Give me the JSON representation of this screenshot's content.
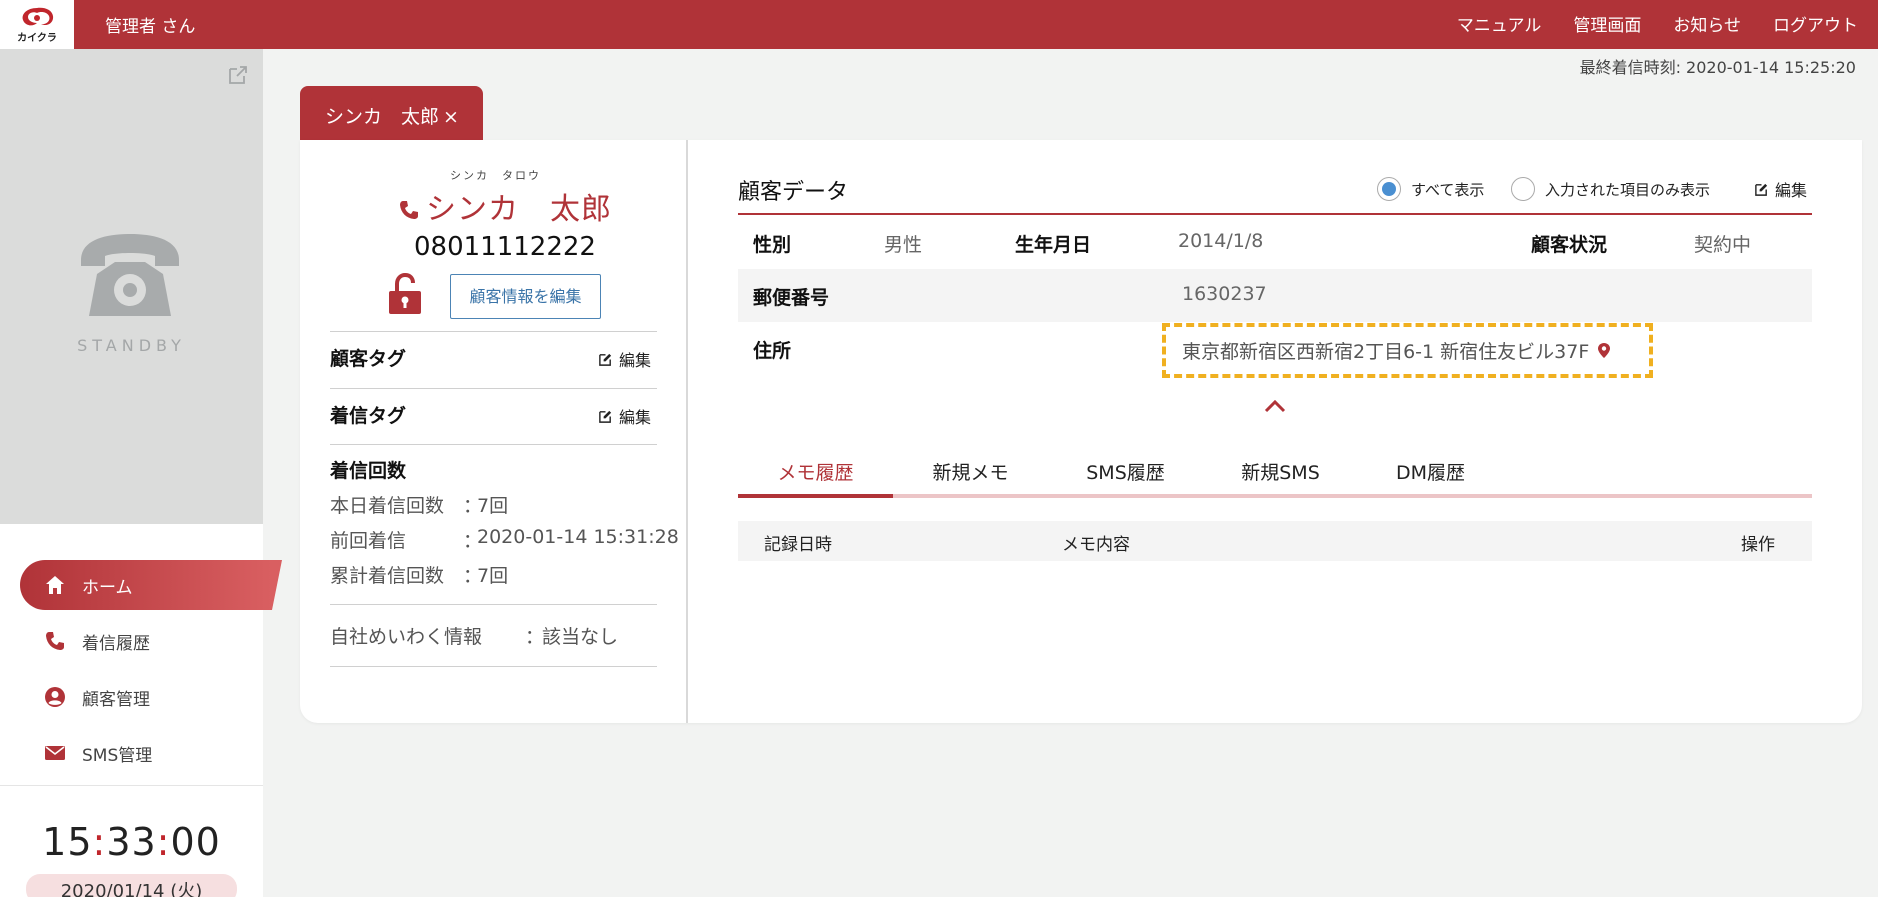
{
  "header": {
    "logo_text": "カイクラ",
    "user_name": "管理者 さん",
    "nav": [
      "マニュアル",
      "管理画面",
      "お知らせ",
      "ログアウト"
    ]
  },
  "last_call": "最終着信時刻: 2020-01-14 15:25:20",
  "sidebar": {
    "status": "STANDBY",
    "items": [
      {
        "label": "ホーム",
        "icon": "home-icon",
        "active": true
      },
      {
        "label": "着信履歴",
        "icon": "phone-icon",
        "active": false
      },
      {
        "label": "顧客管理",
        "icon": "user-circle-icon",
        "active": false
      },
      {
        "label": "SMS管理",
        "icon": "mail-icon",
        "active": false
      }
    ],
    "clock": {
      "h": "15",
      "m": "33",
      "s": "00"
    },
    "date": "2020/01/14 (火)"
  },
  "customer_tab": {
    "label": "シンカ　太郎",
    "close": "×"
  },
  "customer": {
    "kana": "シンカ　タロウ",
    "name": "シンカ　太郎",
    "phone": "08011112222",
    "edit_button": "顧客情報を編集",
    "tag_title": "顧客タグ",
    "call_tag_title": "着信タグ",
    "edit_label": "編集",
    "call_count_title": "着信回数",
    "stats": [
      {
        "label": "本日着信回数",
        "sep": "：",
        "value": "7回"
      },
      {
        "label": "前回着信",
        "sep": "：",
        "value": "2020-01-14 15:31:28"
      },
      {
        "label": "累計着信回数",
        "sep": "：",
        "value": "7回"
      }
    ],
    "meiwaku_label": "自社めいわく情報",
    "meiwaku_sep": "：",
    "meiwaku_value": "該当なし"
  },
  "customer_data": {
    "title": "顧客データ",
    "radio_all": "すべて表示",
    "radio_filled": "入力された項目のみ表示",
    "radio_selected": "すべて表示",
    "edit_label": "編集",
    "gender_label": "性別",
    "gender_value": "男性",
    "birth_label": "生年月日",
    "birth_value": "2014/1/8",
    "status_label": "顧客状況",
    "status_value": "契約中",
    "zip_label": "郵便番号",
    "zip_value": "1630237",
    "address_label": "住所",
    "address_value": "東京都新宿区西新宿2丁目6-1 新宿住友ビル37F"
  },
  "tabs": [
    "メモ履歴",
    "新規メモ",
    "SMS履歴",
    "新規SMS",
    "DM履歴"
  ],
  "active_tab": "メモ履歴",
  "memo_table": {
    "headers": [
      "記録日時",
      "メモ内容",
      "操作"
    ]
  },
  "colors": {
    "brand": "#b03338",
    "highlight": "#f0b020",
    "radio": "#4a8fd1"
  }
}
